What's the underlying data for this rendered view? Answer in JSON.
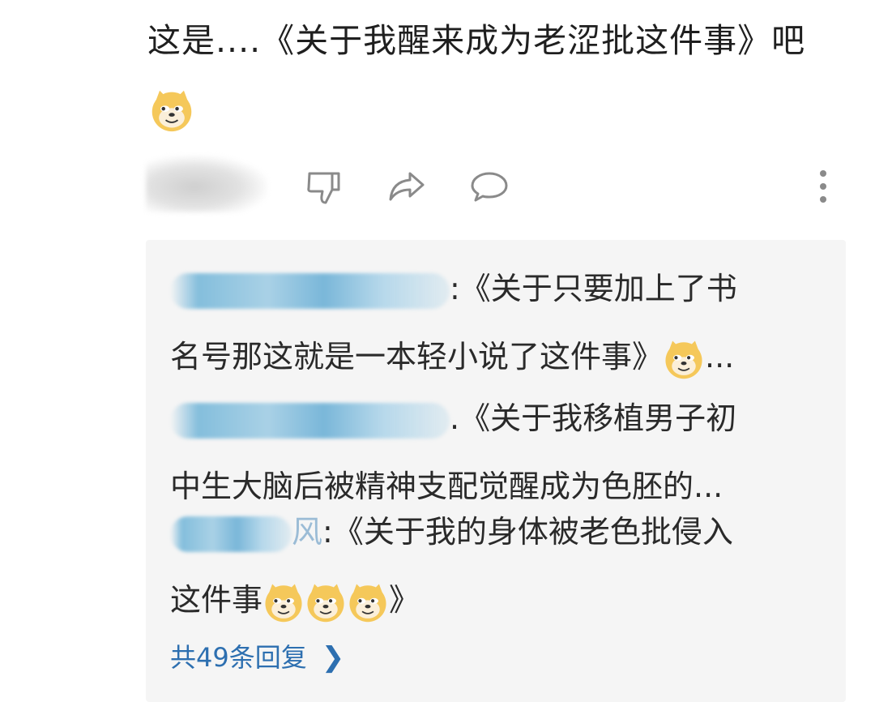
{
  "comment": {
    "text": "这是....《关于我醒来成为老涩批这件事》吧"
  },
  "actions": {
    "dislike": "thumbs-down-icon",
    "share": "share-arrow-icon",
    "reply": "speech-bubble-icon",
    "more": "more-vertical-icon"
  },
  "replies": [
    {
      "text_line1": ":《关于只要加上了书",
      "text_line2": "名号那这就是一本轻小说了这件事》",
      "tail": "..."
    },
    {
      "text_line1": ".《关于我移植男子初",
      "text_line2": "中生大脑后被精神支配觉醒成为色胚的..."
    },
    {
      "name_tail": "风",
      "text_line1": ":《关于我的身体被老色批侵入",
      "text_line2": "这件事",
      "close": "》"
    }
  ],
  "more_replies": "共49条回复",
  "colors": {
    "link": "#2d6fb0",
    "reply_bg": "#f5f5f5",
    "icon": "#8a8a8a"
  }
}
